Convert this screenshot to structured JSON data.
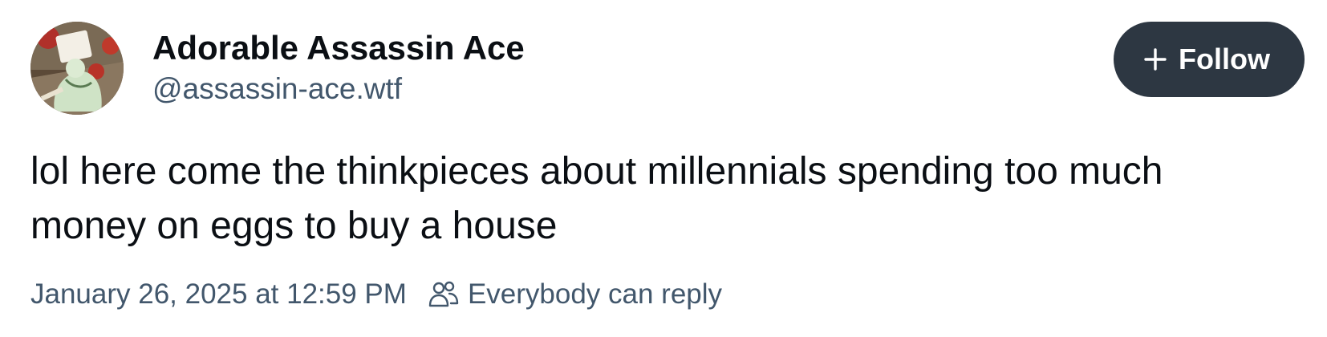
{
  "author": {
    "display_name": "Adorable Assassin Ace",
    "handle": "@assassin-ace.wtf",
    "avatar_icon": "user-avatar"
  },
  "follow_button": {
    "label": "Follow",
    "icon": "plus-icon",
    "background": "#2d3742",
    "text_color": "#ffffff"
  },
  "post": {
    "text": "lol here come the thinkpieces about millennials spending too much money on eggs to buy a house"
  },
  "meta": {
    "timestamp": "January 26, 2025 at 12:59 PM",
    "reply_setting": "Everybody can reply",
    "reply_icon": "people-icon",
    "color": "#42576c"
  }
}
